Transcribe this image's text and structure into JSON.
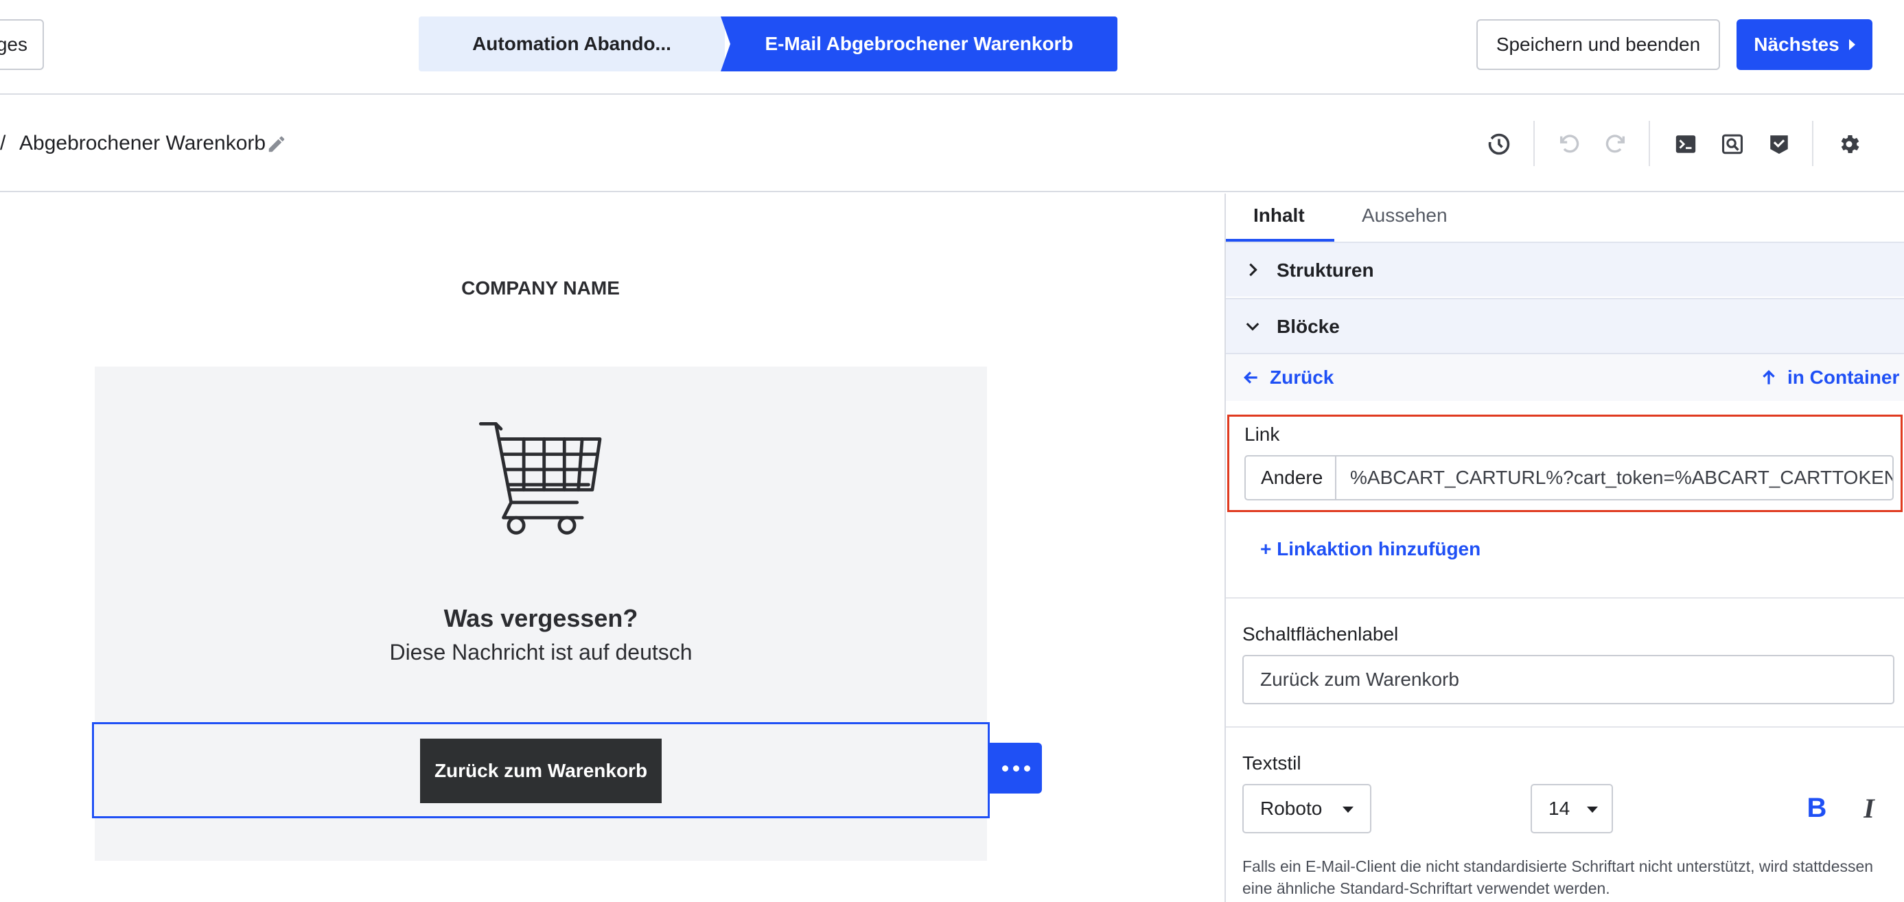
{
  "topbar": {
    "back_label": "ges",
    "steps": [
      {
        "label": "Automation Abando..."
      },
      {
        "label": "E-Mail Abgebrochener Warenkorb"
      }
    ],
    "save_label": "Speichern und beenden",
    "next_label": "Nächstes"
  },
  "toolbar": {
    "slash": "/",
    "title": "Abgebrochener Warenkorb",
    "icons": [
      "history-icon",
      "undo-icon",
      "redo-icon",
      "code-icon",
      "preview-icon",
      "check-icon",
      "gear-icon"
    ]
  },
  "canvas": {
    "company_name": "COMPANY NAME",
    "headline": "Was vergessen?",
    "subline": "Diese Nachricht ist auf deutsch",
    "cta_label": "Zurück zum Warenkorb"
  },
  "panel": {
    "tabs": [
      {
        "label": "Inhalt",
        "active": true
      },
      {
        "label": "Aussehen",
        "active": false
      }
    ],
    "sections": {
      "structures": "Strukturen",
      "blocks": "Blöcke"
    },
    "nav": {
      "back": "Zurück",
      "container": "in Container"
    },
    "link": {
      "label": "Link",
      "type": "Andere",
      "value": "%ABCART_CARTURL%?cart_token=%ABCART_CARTTOKEN%"
    },
    "add_link_action": "+ Linkaktion hinzufügen",
    "button_label": {
      "label": "Schaltflächenlabel",
      "value": "Zurück zum Warenkorb"
    },
    "text_style": {
      "label": "Textstil",
      "font": "Roboto",
      "size": "14",
      "bold_label": "B",
      "italic_label": "I",
      "hint": "Falls ein E-Mail-Client die nicht standardisierte Schriftart nicht unterstützt, wird stattdessen eine ähnliche Standard-Schriftart verwendet werden."
    }
  },
  "colors": {
    "accent": "#1f50f5",
    "highlight_border": "#e03a1f",
    "cta_bg": "#2e3032",
    "email_bg": "#f3f4f6"
  }
}
